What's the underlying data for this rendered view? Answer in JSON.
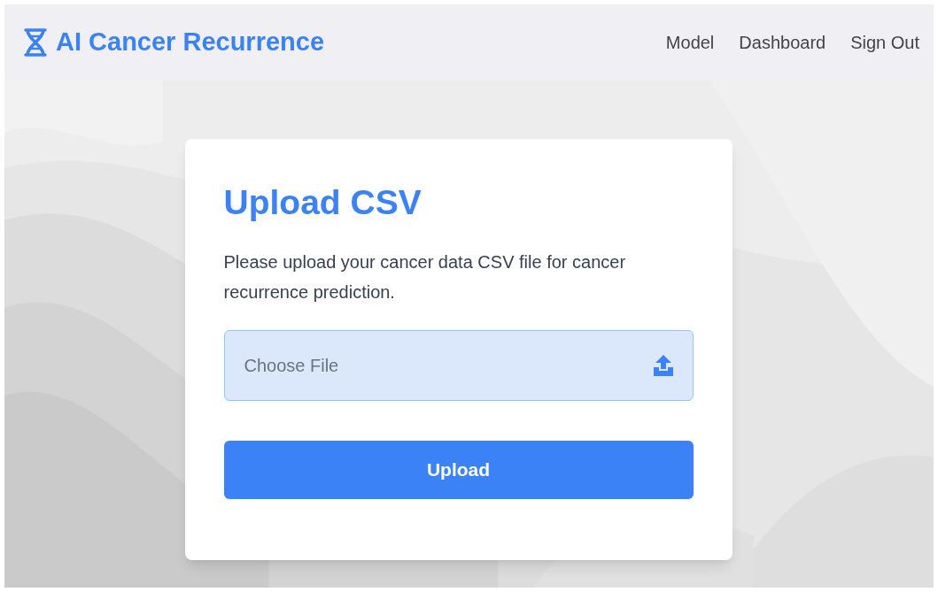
{
  "header": {
    "brand": "AI Cancer Recurrence",
    "nav": [
      {
        "label": "Model"
      },
      {
        "label": "Dashboard"
      },
      {
        "label": "Sign Out"
      }
    ]
  },
  "card": {
    "title": "Upload CSV",
    "description": "Please upload your cancer data CSV file for cancer recurrence prediction.",
    "file_field": {
      "placeholder": "Choose File"
    },
    "submit": "Upload"
  }
}
